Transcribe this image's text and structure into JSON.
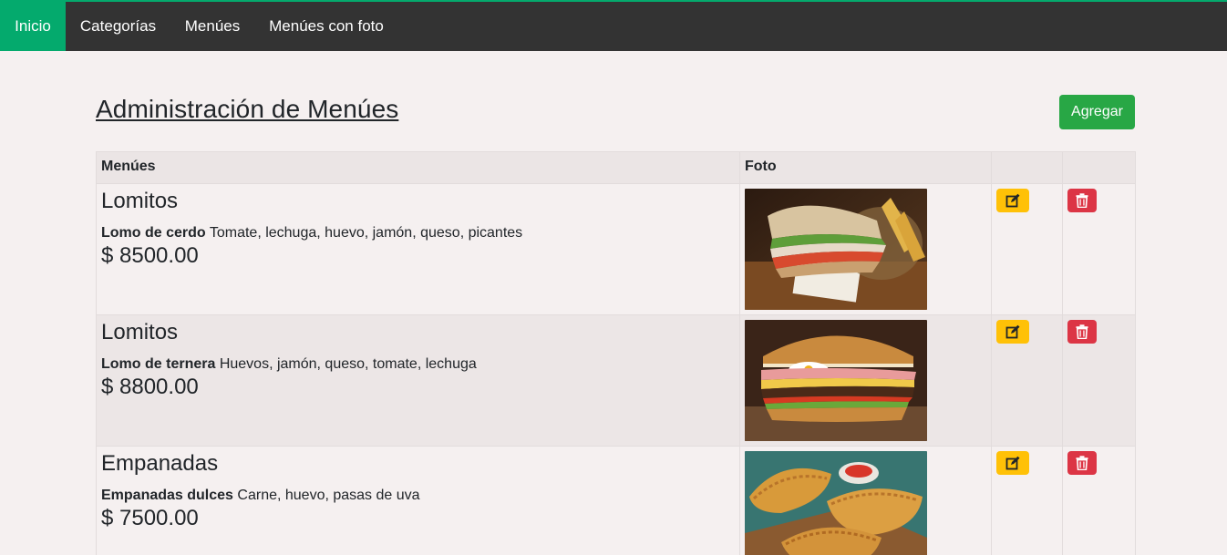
{
  "nav": {
    "items": [
      "Inicio",
      "Categorías",
      "Menúes",
      "Menúes con foto"
    ],
    "active": "Inicio"
  },
  "page": {
    "title": "Administración de Menúes",
    "add_button": "Agregar"
  },
  "table": {
    "headers": [
      "Menúes",
      "Foto",
      "",
      ""
    ],
    "rows": [
      {
        "category": "Lomitos",
        "name": "Lomo de cerdo",
        "ingredients": "Tomate, lechuga, huevo, jamón, queso, picantes",
        "price": "$ 8500.00",
        "photo": "sandwich-photo"
      },
      {
        "category": "Lomitos",
        "name": "Lomo de ternera",
        "ingredients": "Huevos, jamón, queso, tomate, lechuga",
        "price": "$ 8800.00",
        "photo": "sandwich-photo"
      },
      {
        "category": "Empanadas",
        "name": "Empanadas dulces",
        "ingredients": "Carne, huevo, pasas de uva",
        "price": "$ 7500.00",
        "photo": "empanadas-photo"
      }
    ]
  },
  "colors": {
    "nav_bg": "#333333",
    "nav_active": "#04aa6d",
    "add_button": "#28a745",
    "edit_button": "#ffc107",
    "delete_button": "#dc3545"
  },
  "icons": {
    "edit": "edit-icon",
    "delete": "trash-icon"
  }
}
